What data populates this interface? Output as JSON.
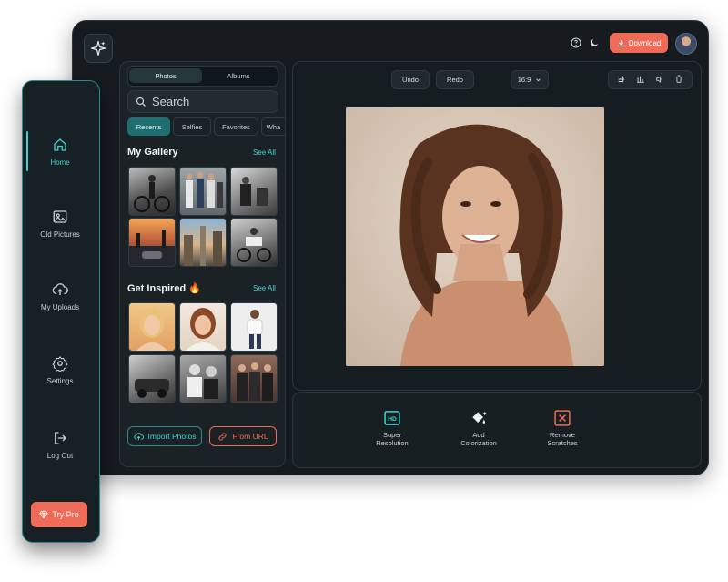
{
  "header": {
    "download_label": "Download",
    "help_icon": "help-circle-icon",
    "theme_icon": "theme-toggle-icon"
  },
  "sidebar": {
    "items": [
      {
        "label": "Home",
        "icon": "home-icon",
        "active": true
      },
      {
        "label": "Old Pictures",
        "icon": "image-icon",
        "active": false
      },
      {
        "label": "My Uploads",
        "icon": "cloud-upload-icon",
        "active": false
      },
      {
        "label": "Settings",
        "icon": "gear-icon",
        "active": false
      },
      {
        "label": "Log Out",
        "icon": "logout-icon",
        "active": false
      }
    ],
    "try_pro_label": "Try Pro"
  },
  "gallery": {
    "tabs": [
      "Photos",
      "Albums"
    ],
    "active_tab": "Photos",
    "search_placeholder": "Search",
    "filters": [
      "Recents",
      "Selfies",
      "Favorites",
      "Wha"
    ],
    "active_filter": "Recents",
    "my_gallery_title": "My Gallery",
    "get_inspired_title": "Get Inspired 🔥",
    "see_all_label": "See All",
    "import_label": "Import Photos",
    "from_url_label": "From URL"
  },
  "editor": {
    "undo_label": "Undo",
    "redo_label": "Redo",
    "aspect_ratio": "16:9",
    "tools": [
      {
        "label": "Super Resolution",
        "icon": "hd-icon"
      },
      {
        "label": "Add Colorization",
        "icon": "paint-bucket-icon"
      },
      {
        "label": "Remove Scratches",
        "icon": "remove-icon"
      }
    ]
  },
  "colors": {
    "accent": "#3dd3cd",
    "brand": "#ee6b57",
    "background": "#151b1f"
  }
}
